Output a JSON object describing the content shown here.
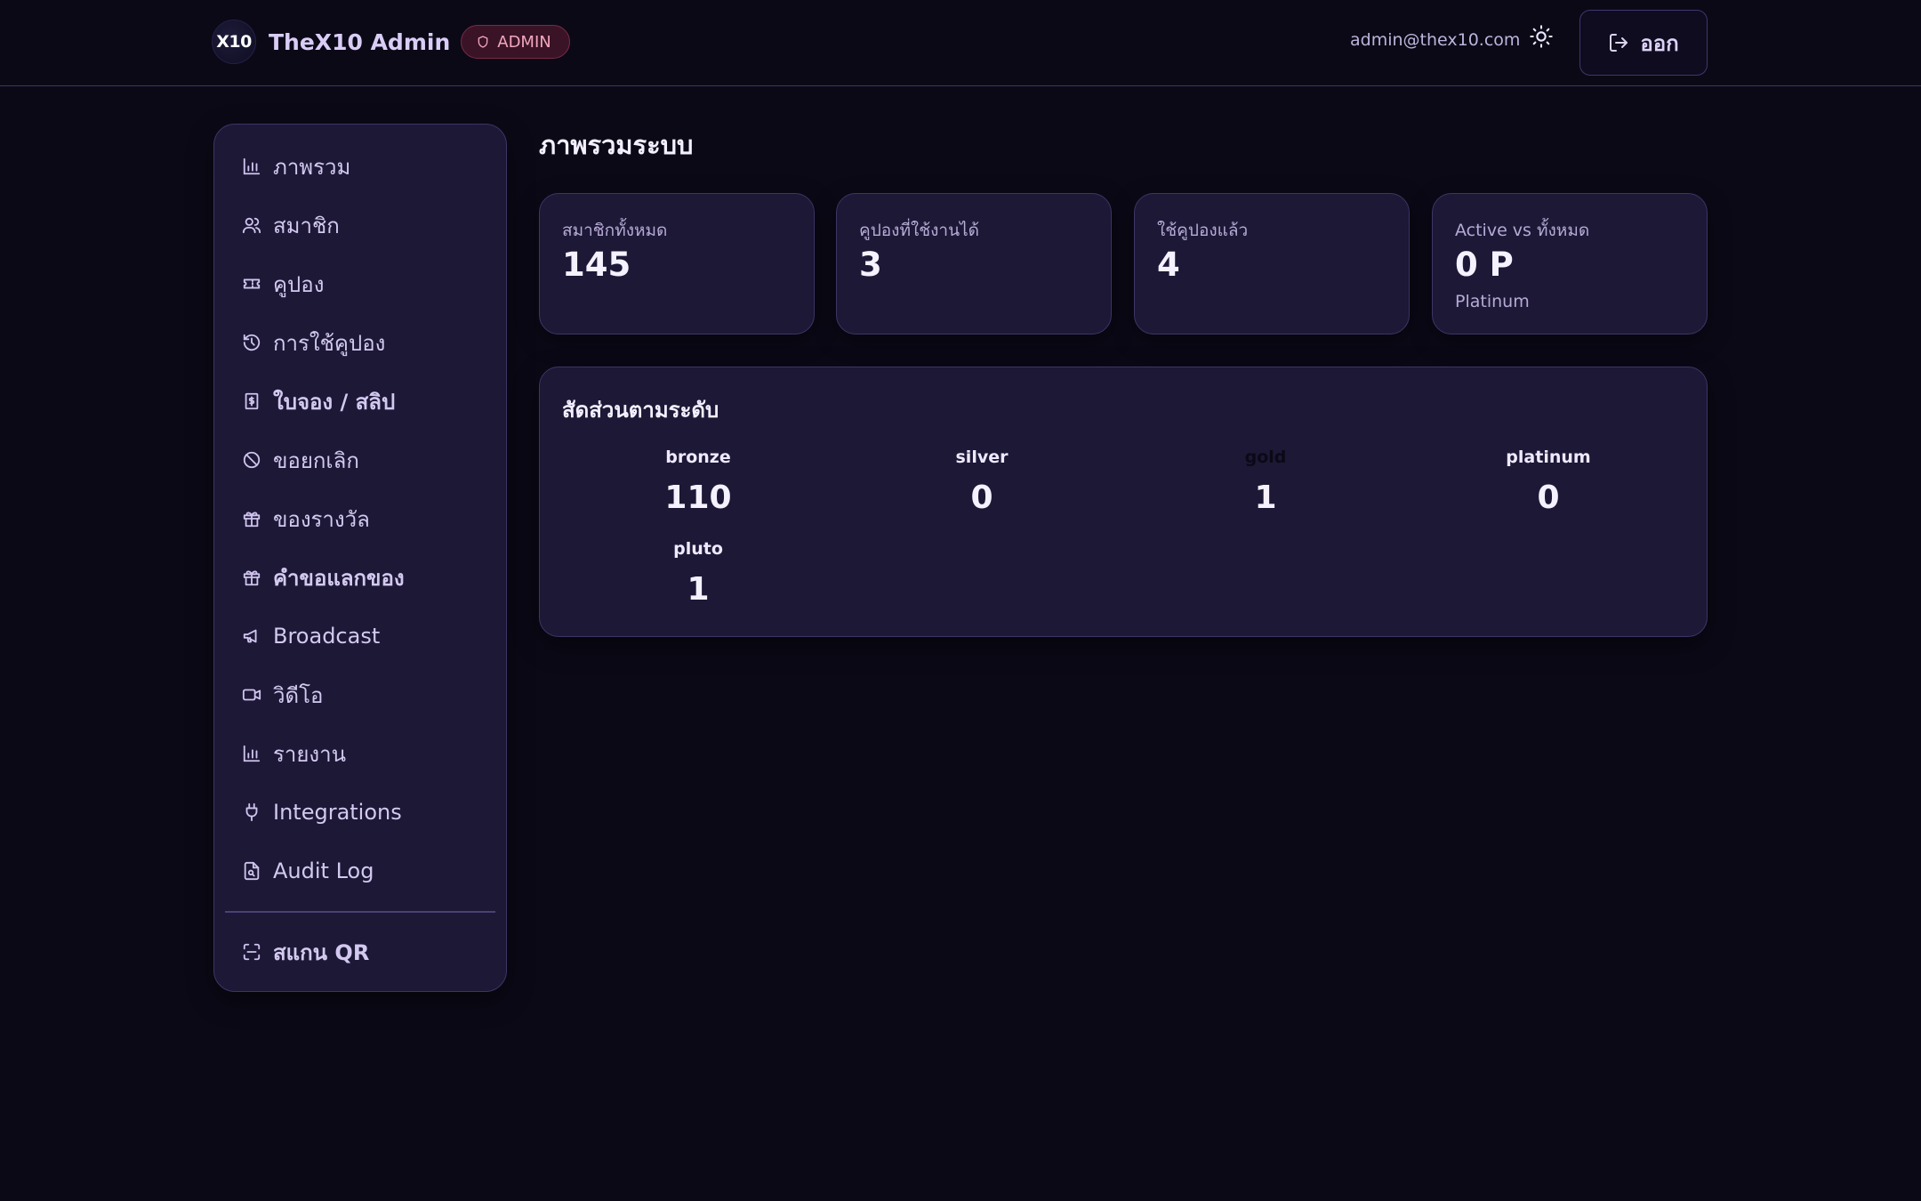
{
  "header": {
    "logo_text": "X10",
    "title": "TheX10 Admin",
    "badge": "ADMIN",
    "user_email": "admin@thex10.com",
    "logout_label": "ออก"
  },
  "sidebar": {
    "items": [
      {
        "label": "ภาพรวม",
        "icon": "bar-chart-icon"
      },
      {
        "label": "สมาชิก",
        "icon": "users-icon"
      },
      {
        "label": "คูปอง",
        "icon": "ticket-icon"
      },
      {
        "label": "การใช้คูปอง",
        "icon": "history-icon"
      },
      {
        "label": "ใบจอง / สลิป",
        "icon": "receipt-dollar-icon"
      },
      {
        "label": "ขอยกเลิก",
        "icon": "ban-icon"
      },
      {
        "label": "ของรางวัล",
        "icon": "gift-icon"
      },
      {
        "label": "คำขอแลกของ",
        "icon": "gift-icon"
      },
      {
        "label": "Broadcast",
        "icon": "megaphone-icon"
      },
      {
        "label": "วิดีโอ",
        "icon": "video-icon"
      },
      {
        "label": "รายงาน",
        "icon": "bar-chart-icon"
      },
      {
        "label": "Integrations",
        "icon": "plug-icon"
      },
      {
        "label": "Audit Log",
        "icon": "file-search-icon"
      }
    ],
    "scan": {
      "label": "สแกน QR",
      "icon": "scan-qr-icon"
    }
  },
  "main": {
    "title": "ภาพรวมระบบ",
    "stats": [
      {
        "label": "สมาชิกทั้งหมด",
        "value": "145",
        "sub": ""
      },
      {
        "label": "คูปองที่ใช้งานได้",
        "value": "3",
        "sub": ""
      },
      {
        "label": "ใช้คูปองแล้ว",
        "value": "4",
        "sub": ""
      },
      {
        "label": "Active vs ทั้งหมด",
        "value": "0 P",
        "sub": "Platinum"
      }
    ],
    "distribution": {
      "title": "สัดส่วนตามระดับ",
      "tiers": [
        {
          "name": "bronze",
          "value": "110"
        },
        {
          "name": "silver",
          "value": "0"
        },
        {
          "name": "gold",
          "value": "1"
        },
        {
          "name": "platinum",
          "value": "0"
        },
        {
          "name": "pluto",
          "value": "1"
        }
      ]
    }
  },
  "colors": {
    "background": "#0b0916",
    "card": "#1d1836",
    "border": "#3d3566",
    "badge_bg": "#3a1426",
    "badge_text": "#f2a6bd"
  }
}
